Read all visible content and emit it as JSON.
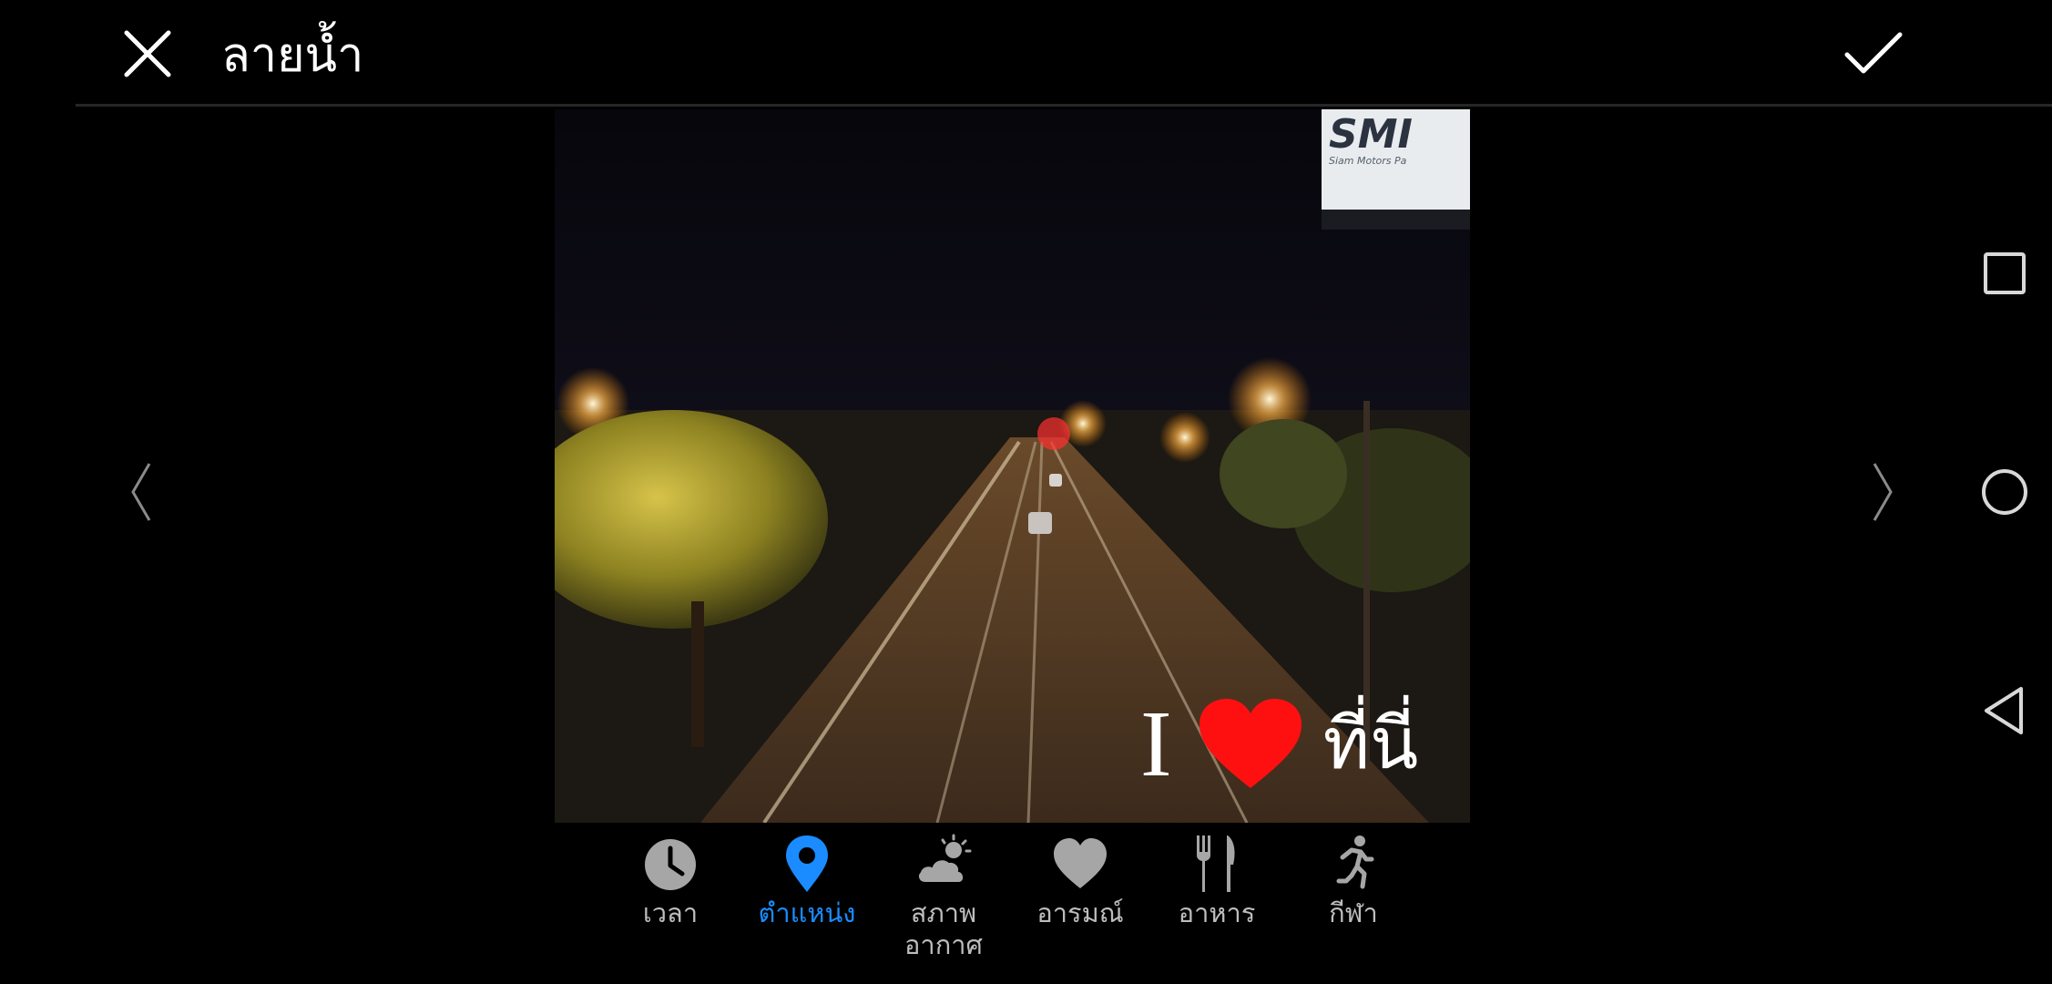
{
  "header": {
    "title": "ลายน้ำ"
  },
  "photo": {
    "billboard_text": "SMI",
    "billboard_subtext": "Siam Motors Pa",
    "watermark": {
      "prefix": "I",
      "suffix": "ที่นี่"
    }
  },
  "tabs": [
    {
      "label": "เวลา",
      "icon": "clock-icon",
      "active": false
    },
    {
      "label": "ตำแหน่ง",
      "icon": "location-pin-icon",
      "active": true
    },
    {
      "label": "สภาพ\nอากาศ",
      "icon": "weather-icon",
      "active": false
    },
    {
      "label": "อารมณ์",
      "icon": "heart-icon",
      "active": false
    },
    {
      "label": "อาหาร",
      "icon": "fork-knife-icon",
      "active": false
    },
    {
      "label": "กีฬา",
      "icon": "running-icon",
      "active": false
    }
  ],
  "colors": {
    "accent": "#1a8cff",
    "tab_inactive": "#bdbdbd",
    "icon_inactive": "#a6a6a6",
    "heart": "#ff1010"
  }
}
